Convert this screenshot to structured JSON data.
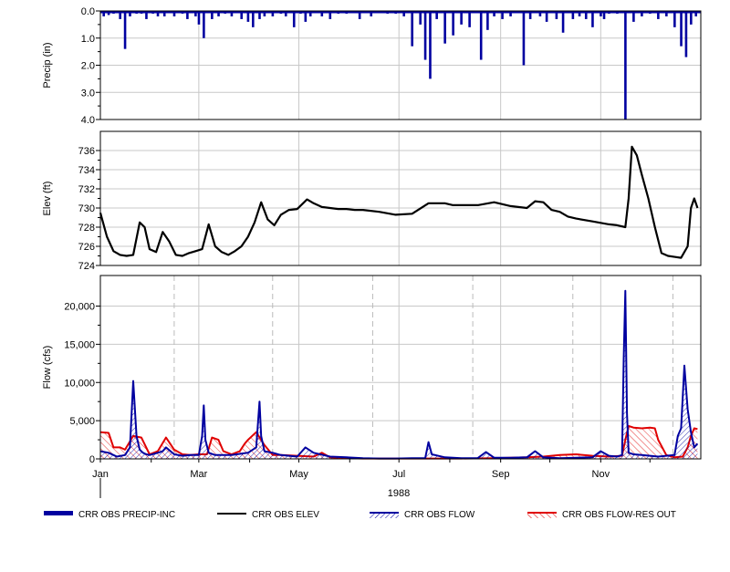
{
  "chart_data": {
    "type": "line",
    "x_tick_labels": [
      "Jan",
      "Mar",
      "May",
      "Jul",
      "Sep",
      "Nov"
    ],
    "x_tick_months": [
      0,
      2,
      4,
      6,
      8,
      10
    ],
    "year_label": "1988",
    "panels": [
      {
        "id": "precip",
        "type": "bar",
        "ylabel": "Precip (in)",
        "ylim": [
          0,
          4
        ],
        "inverted": true,
        "y_tick_labels": [
          "0.0",
          "1.0",
          "2.0",
          "3.0",
          "4.0"
        ],
        "y_tick_values": [
          0,
          1,
          2,
          3,
          4
        ],
        "series": [
          {
            "name": "CRR OBS PRECIP-INC",
            "color": "#0000a0",
            "x": [
              2,
              5,
              8,
              12,
              15,
              18,
              22,
              25,
              28,
              32,
              35,
              39,
              45,
              50,
              53,
              58,
              60,
              63,
              68,
              72,
              76,
              80,
              86,
              90,
              93,
              97,
              100,
              105,
              110,
              113,
              118,
              122,
              125,
              128,
              135,
              140,
              145,
              150,
              158,
              165,
              175,
              180,
              185,
              190,
              195,
              198,
              201,
              205,
              210,
              215,
              220,
              225,
              232,
              236,
              240,
              245,
              250,
              258,
              262,
              268,
              272,
              278,
              282,
              288,
              292,
              296,
              300,
              305,
              307,
              310,
              315,
              320,
              325,
              330,
              335,
              340,
              345,
              350,
              354,
              357,
              360,
              363
            ],
            "values": [
              0.2,
              0.15,
              0.1,
              0.3,
              1.4,
              0.2,
              0.1,
              0.1,
              0.3,
              0.1,
              0.2,
              0.2,
              0.2,
              0.1,
              0.3,
              0.2,
              0.5,
              1.0,
              0.3,
              0.2,
              0.1,
              0.2,
              0.3,
              0.4,
              0.6,
              0.3,
              0.2,
              0.2,
              0.1,
              0.2,
              0.6,
              0.1,
              0.4,
              0.2,
              0.2,
              0.3,
              0.1,
              0.1,
              0.3,
              0.2,
              0.1,
              0.1,
              0.2,
              1.3,
              0.5,
              1.8,
              2.5,
              0.3,
              1.2,
              0.9,
              0.5,
              0.6,
              1.8,
              0.7,
              0.2,
              0.3,
              0.2,
              2.0,
              0.3,
              0.2,
              0.4,
              0.3,
              0.8,
              0.3,
              0.2,
              0.3,
              0.6,
              0.2,
              0.3,
              0.1,
              0.1,
              4.0,
              0.4,
              0.2,
              0.1,
              0.3,
              0.2,
              0.6,
              1.3,
              1.7,
              0.5,
              0.2
            ]
          }
        ]
      },
      {
        "id": "elev",
        "type": "line",
        "ylabel": "Elev (ft)",
        "ylim": [
          724,
          738
        ],
        "y_tick_labels": [
          "724",
          "726",
          "728",
          "730",
          "732",
          "734",
          "736"
        ],
        "y_tick_values": [
          724,
          726,
          728,
          730,
          732,
          734,
          736
        ],
        "series": [
          {
            "name": "CRR OBS ELEV",
            "color": "#000000",
            "x": [
              0,
              4,
              8,
              12,
              16,
              20,
              24,
              27,
              30,
              34,
              38,
              42,
              46,
              50,
              54,
              58,
              62,
              66,
              70,
              74,
              78,
              82,
              86,
              90,
              94,
              98,
              102,
              106,
              110,
              115,
              120,
              126,
              130,
              135,
              140,
              145,
              150,
              155,
              160,
              170,
              180,
              190,
              200,
              206,
              210,
              215,
              220,
              230,
              240,
              250,
              260,
              265,
              270,
              275,
              280,
              285,
              290,
              300,
              310,
              315,
              320,
              322,
              324,
              327,
              330,
              334,
              338,
              342,
              346,
              350,
              354,
              358,
              360,
              362,
              364
            ],
            "values": [
              729.5,
              727,
              725.5,
              725.1,
              725,
              725.1,
              728.5,
              728,
              725.7,
              725.4,
              727.5,
              726.5,
              725.1,
              725,
              725.3,
              725.5,
              725.7,
              728.3,
              726,
              725.4,
              725.1,
              725.5,
              726,
              727,
              728.5,
              730.6,
              728.8,
              728.2,
              729.3,
              729.8,
              729.9,
              730.9,
              730.5,
              730.1,
              730,
              729.9,
              729.9,
              729.8,
              729.8,
              729.6,
              729.3,
              729.4,
              730.5,
              730.5,
              730.5,
              730.3,
              730.3,
              730.3,
              730.6,
              730.2,
              730,
              730.7,
              730.6,
              729.8,
              729.6,
              729.1,
              728.9,
              728.6,
              728.3,
              728.2,
              728,
              731,
              736.4,
              735.5,
              733.5,
              731,
              728,
              725.3,
              725,
              724.9,
              724.8,
              726,
              730,
              731,
              730
            ]
          }
        ]
      },
      {
        "id": "flow",
        "type": "line",
        "ylabel": "Flow (cfs)",
        "ylim": [
          0,
          24000
        ],
        "y_tick_labels": [
          "0",
          "5,000",
          "10,000",
          "15,000",
          "20,000"
        ],
        "y_tick_values": [
          0,
          5000,
          10000,
          15000,
          20000
        ],
        "series": [
          {
            "name": "CRR OBS FLOW",
            "color": "#0000a0",
            "x": [
              0,
              5,
              10,
              15,
              18,
              20,
              22,
              24,
              26,
              28,
              30,
              35,
              38,
              40,
              45,
              50,
              55,
              60,
              62,
              63,
              64,
              66,
              70,
              80,
              90,
              95,
              97,
              98,
              100,
              105,
              110,
              120,
              125,
              130,
              140,
              150,
              160,
              170,
              180,
              190,
              198,
              200,
              202,
              210,
              220,
              230,
              235,
              240,
              250,
              260,
              265,
              270,
              280,
              290,
              300,
              305,
              310,
              315,
              318,
              319,
              320,
              321,
              322,
              325,
              330,
              340,
              350,
              352,
              354,
              356,
              358,
              360,
              362,
              364
            ],
            "values": [
              1000,
              800,
              300,
              500,
              1500,
              10200,
              3000,
              1200,
              800,
              600,
              500,
              800,
              1000,
              1500,
              600,
              400,
              500,
              500,
              3000,
              7000,
              2500,
              800,
              500,
              500,
              800,
              1500,
              7500,
              3000,
              1000,
              800,
              500,
              300,
              1500,
              800,
              300,
              200,
              100,
              50,
              50,
              80,
              100,
              2200,
              600,
              200,
              100,
              100,
              900,
              150,
              150,
              200,
              1000,
              200,
              100,
              150,
              200,
              1000,
              400,
              300,
              500,
              13000,
              22000,
              6000,
              800,
              600,
              500,
              300,
              500,
              3000,
              4000,
              12200,
              6500,
              3500,
              1500,
              2000
            ]
          },
          {
            "name": "CRR OBS FLOW-RES OUT",
            "color": "#e00000",
            "x": [
              0,
              5,
              8,
              12,
              15,
              20,
              25,
              30,
              35,
              40,
              45,
              50,
              55,
              60,
              65,
              68,
              72,
              75,
              80,
              85,
              88,
              90,
              95,
              100,
              105,
              110,
              120,
              130,
              135,
              140,
              150,
              160,
              170,
              180,
              200,
              220,
              240,
              260,
              270,
              280,
              290,
              300,
              310,
              318,
              320,
              322,
              325,
              330,
              335,
              338,
              340,
              345,
              350,
              355,
              358,
              360,
              362,
              364
            ],
            "values": [
              3500,
              3400,
              1500,
              1500,
              1200,
              3000,
              2800,
              600,
              1000,
              2800,
              1200,
              600,
              500,
              600,
              600,
              2800,
              2500,
              1000,
              600,
              1000,
              2000,
              2500,
              3500,
              1800,
              500,
              500,
              400,
              300,
              800,
              200,
              100,
              50,
              50,
              50,
              50,
              50,
              100,
              200,
              300,
              500,
              600,
              400,
              300,
              400,
              2500,
              4300,
              4100,
              4000,
              4100,
              4000,
              2500,
              500,
              200,
              300,
              1500,
              3000,
              4000,
              3900
            ]
          }
        ]
      }
    ],
    "legend": [
      {
        "label": "CRR OBS PRECIP-INC",
        "color": "#0000a0",
        "style": "thick"
      },
      {
        "label": "CRR OBS ELEV",
        "color": "#000000",
        "style": "line"
      },
      {
        "label": "CRR OBS FLOW",
        "color": "#0000a0",
        "style": "hatch"
      },
      {
        "label": "CRR OBS FLOW-RES OUT",
        "color": "#e00000",
        "style": "hatch"
      }
    ],
    "grid": true
  }
}
